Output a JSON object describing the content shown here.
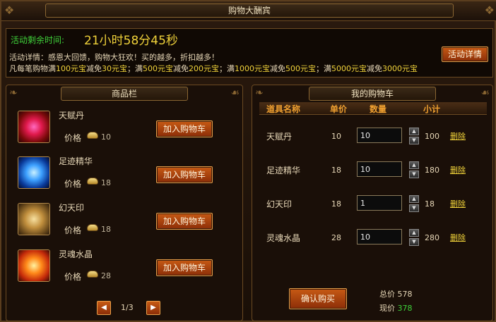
{
  "window": {
    "title": "购物大酬宾"
  },
  "event": {
    "timer_label": "活动剩余时间:",
    "timer_value": "21小时58分45秒",
    "detail": "活动详情：感恩大回馈，购物大狂欢！买的越多，折扣越多！",
    "offers": {
      "prefix": "凡每笔购物满",
      "a1": "100元宝",
      "t1": "减免",
      "b1": "30元宝",
      "s1": "；满",
      "a2": "500元宝",
      "t2": "减免",
      "b2": "200元宝",
      "s2": "；满",
      "a3": "1000元宝",
      "t3": "减免",
      "b3": "500元宝",
      "s3": "；满",
      "a4": "5000元宝",
      "t4": "减免",
      "b4": "3000元宝"
    },
    "details_button": "活动详情"
  },
  "shop": {
    "title": "商品栏",
    "items": [
      {
        "name": "天赋丹",
        "price_label": "价格",
        "price": "10",
        "icon": "red-pill-icon",
        "button": "加入购物车"
      },
      {
        "name": "足迹精华",
        "price_label": "价格",
        "price": "18",
        "icon": "blue-orb-icon",
        "button": "加入购物车"
      },
      {
        "name": "幻天印",
        "price_label": "价格",
        "price": "18",
        "icon": "golden-seal-icon",
        "button": "加入购物车"
      },
      {
        "name": "灵魂水晶",
        "price_label": "价格",
        "price": "28",
        "icon": "fire-crystal-icon",
        "button": "加入购物车"
      }
    ],
    "pager": {
      "text": "1/3"
    }
  },
  "cart": {
    "title": "我的购物车",
    "headers": {
      "name": "道具名称",
      "price": "单价",
      "qty": "数量",
      "subtotal": "小计"
    },
    "rows": [
      {
        "name": "天赋丹",
        "price": "10",
        "qty": "10",
        "subtotal": "100",
        "delete": "删除"
      },
      {
        "name": "足迹精华",
        "price": "18",
        "qty": "10",
        "subtotal": "180",
        "delete": "删除"
      },
      {
        "name": "幻天印",
        "price": "18",
        "qty": "1",
        "subtotal": "18",
        "delete": "删除"
      },
      {
        "name": "灵魂水晶",
        "price": "28",
        "qty": "10",
        "subtotal": "280",
        "delete": "删除"
      }
    ],
    "confirm_button": "确认购买",
    "total_label": "总价",
    "total_value": "578",
    "now_label": "现价",
    "now_value": "378"
  },
  "colors": {
    "accent_gold": "#f0d23a",
    "accent_green": "#3fd23a",
    "button_orange": "#c75a14"
  }
}
